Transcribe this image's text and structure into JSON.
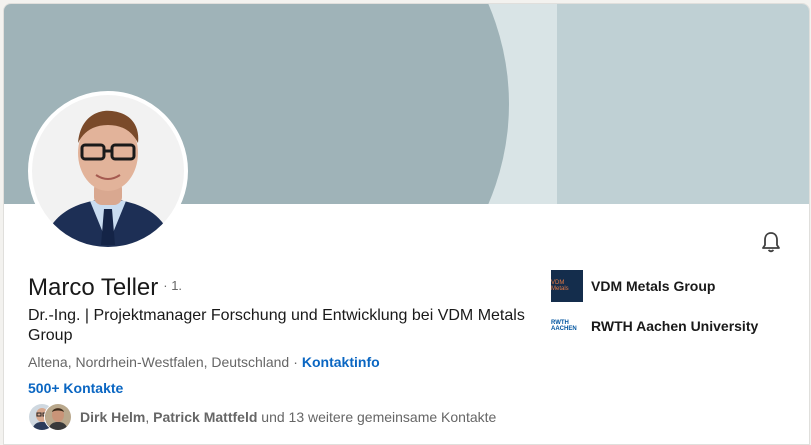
{
  "profile": {
    "name": "Marco Teller",
    "degree": "· 1.",
    "headline": "Dr.-Ing. | Projektmanager Forschung und Entwicklung bei VDM Metals Group",
    "location": "Altena, Nordrhein-Westfalen, Deutschland",
    "location_separator": "·",
    "contact_info_label": "Kontaktinfo",
    "contacts_label": "500+ Kontakte"
  },
  "mutual": {
    "name1": "Dirk Helm",
    "comma": ", ",
    "name2": "Patrick Mattfeld",
    "rest": " und 13 weitere gemeinsame Kontakte"
  },
  "orgs": [
    {
      "name": "VDM Metals Group",
      "logo_text": "VDM Metals",
      "icon": "company-logo"
    },
    {
      "name": "RWTH Aachen University",
      "logo_text": "RWTH AACHEN",
      "icon": "university-logo"
    }
  ],
  "icons": {
    "notify": "bell-icon"
  },
  "colors": {
    "link": "#0a66c2",
    "banner": "#9fb3b8",
    "banner_light": "#bfd0d4"
  }
}
